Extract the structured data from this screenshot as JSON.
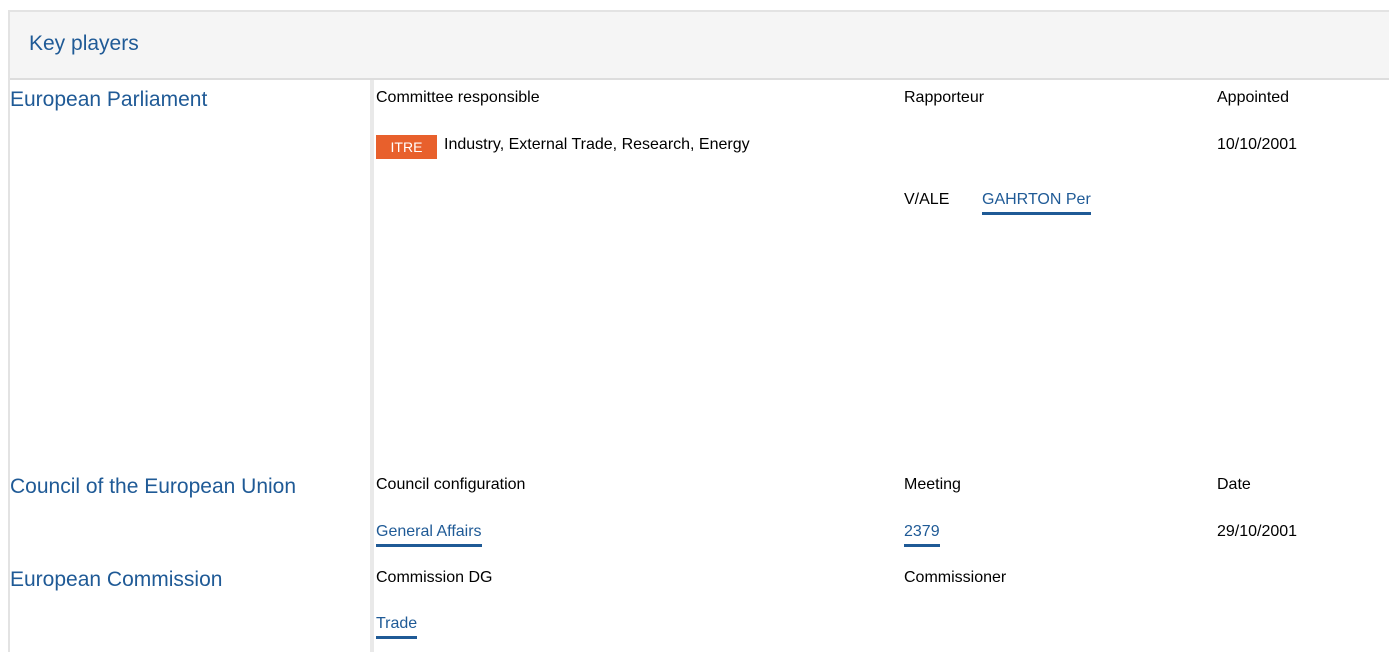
{
  "section": {
    "title": "Key players"
  },
  "parliament": {
    "name": "European Parliament",
    "col_committee": "Committee responsible",
    "col_rapporteur": "Rapporteur",
    "col_appointed": "Appointed",
    "committee_code": "ITRE",
    "committee_name": "Industry, External Trade, Research, Energy",
    "appointed_date": "10/10/2001",
    "rapporteur_group": "V/ALE",
    "rapporteur_name": "GAHRTON Per",
    "colors": {
      "badge": "#e8602c",
      "link": "#1f5a96"
    }
  },
  "council": {
    "name": "Council of the European Union",
    "col_configuration": "Council configuration",
    "col_meeting": "Meeting",
    "col_date": "Date",
    "configuration": "General Affairs",
    "meeting": "2379",
    "date": "29/10/2001"
  },
  "commission": {
    "name": "European Commission",
    "col_dg": "Commission DG",
    "col_commissioner": "Commissioner",
    "dg": "Trade"
  }
}
